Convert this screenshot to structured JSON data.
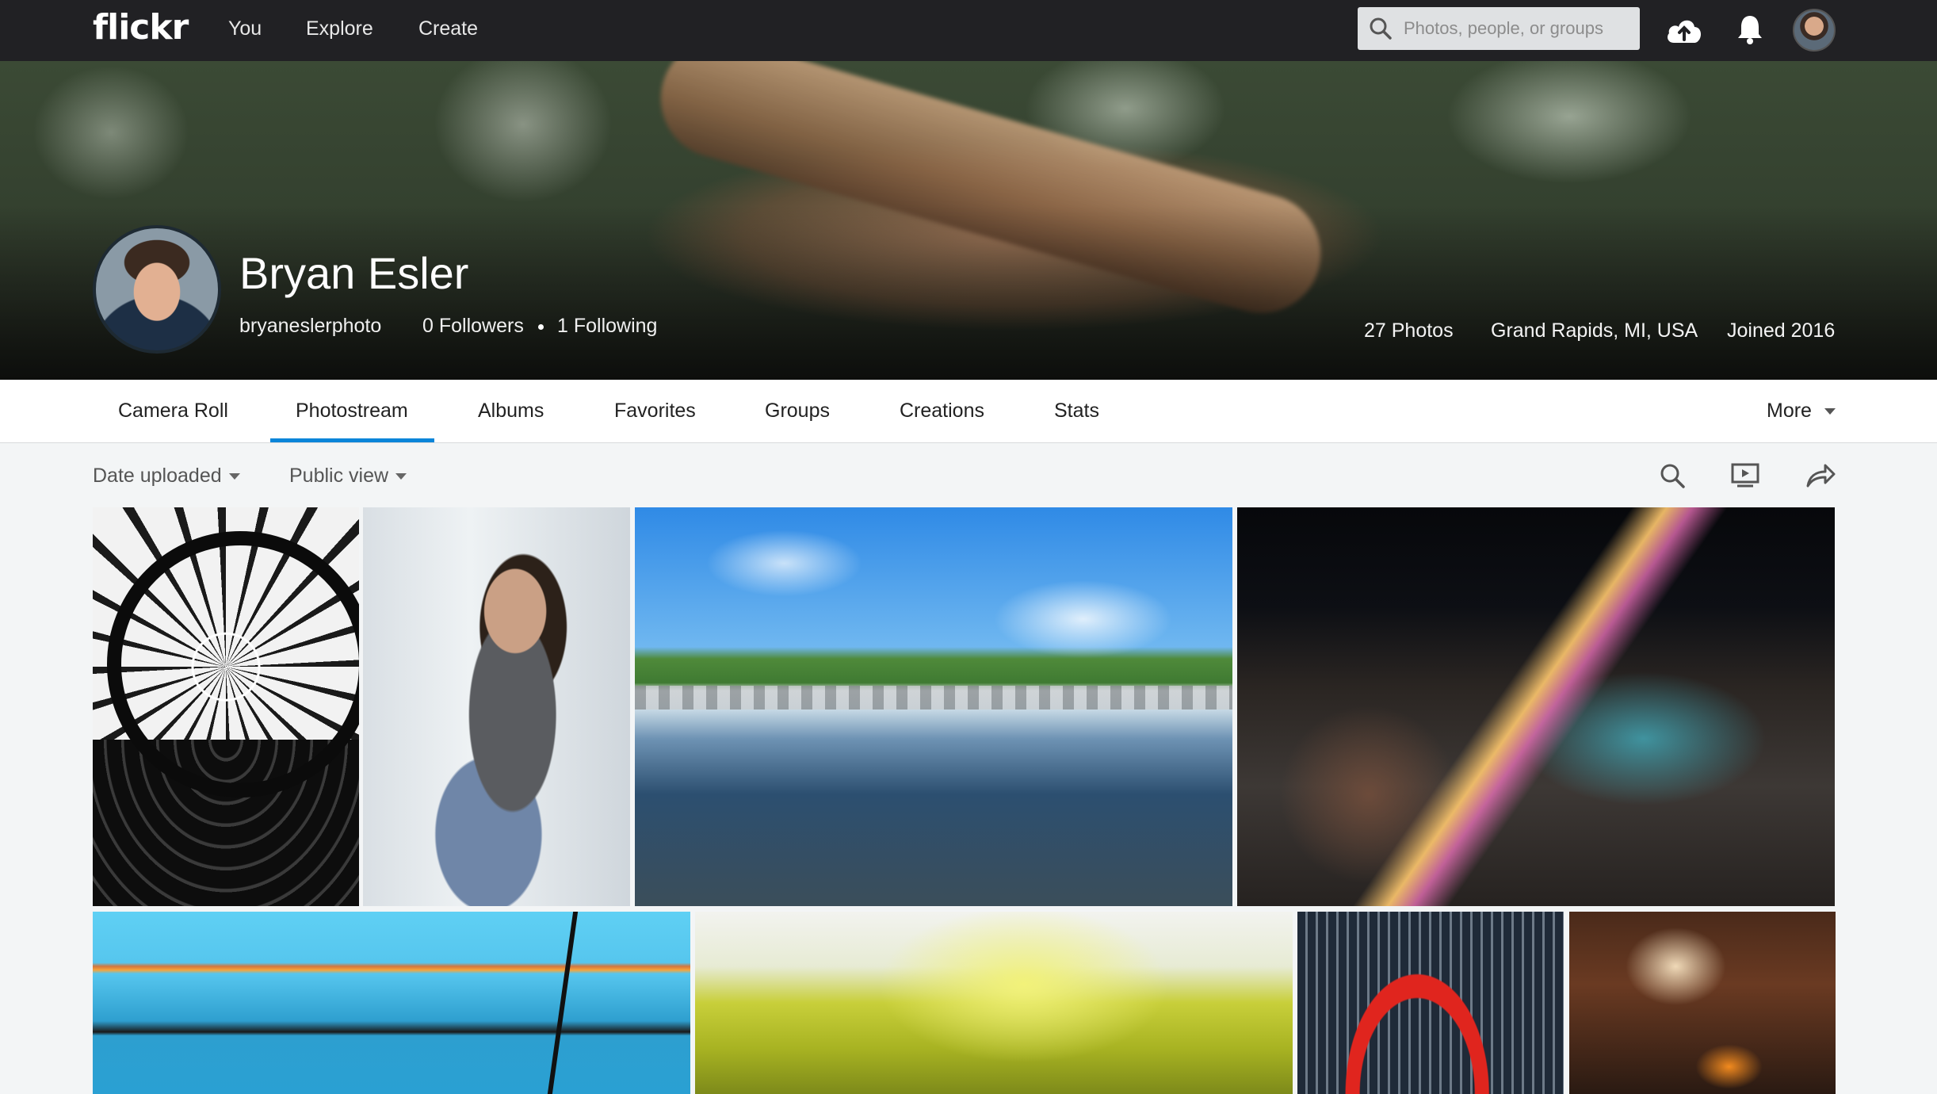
{
  "topbar": {
    "logo": "flickr",
    "nav": [
      "You",
      "Explore",
      "Create"
    ],
    "search_placeholder": "Photos, people, or groups"
  },
  "profile": {
    "name": "Bryan Esler",
    "username": "bryaneslerphoto",
    "followers": "0 Followers",
    "following": "1 Following",
    "photos": "27 Photos",
    "location": "Grand Rapids, MI, USA",
    "joined": "Joined 2016"
  },
  "tabs": [
    {
      "label": "Camera Roll"
    },
    {
      "label": "Photostream",
      "active": true
    },
    {
      "label": "Albums"
    },
    {
      "label": "Favorites"
    },
    {
      "label": "Groups"
    },
    {
      "label": "Creations"
    },
    {
      "label": "Stats"
    }
  ],
  "more_label": "More",
  "toolbar": {
    "sort_label": "Date uploaded",
    "view_label": "Public view"
  },
  "colors": {
    "topbar": "#212124",
    "active_tab": "#0a85d9",
    "page_bg": "#f3f5f6"
  },
  "icons": [
    "search-icon",
    "upload-cloud-icon",
    "bell-icon",
    "slideshow-icon",
    "share-icon"
  ]
}
